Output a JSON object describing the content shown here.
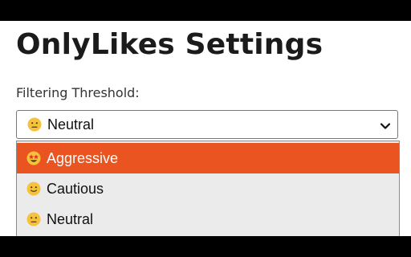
{
  "page": {
    "title": "OnlyLikes Settings",
    "threshold_label": "Filtering Threshold:"
  },
  "select": {
    "current_value": "Neutral",
    "current_icon": "neutral-face-emoji-icon",
    "options": [
      {
        "label": "Aggressive",
        "icon": "star-struck-emoji-icon",
        "highlighted": true
      },
      {
        "label": "Cautious",
        "icon": "slightly-smiling-emoji-icon",
        "highlighted": false
      },
      {
        "label": "Neutral",
        "icon": "neutral-face-emoji-icon",
        "highlighted": false
      }
    ]
  },
  "colors": {
    "highlight": "#e95420",
    "emoji_yellow": "#f5c33b",
    "text_dark": "#1b1b1b"
  }
}
